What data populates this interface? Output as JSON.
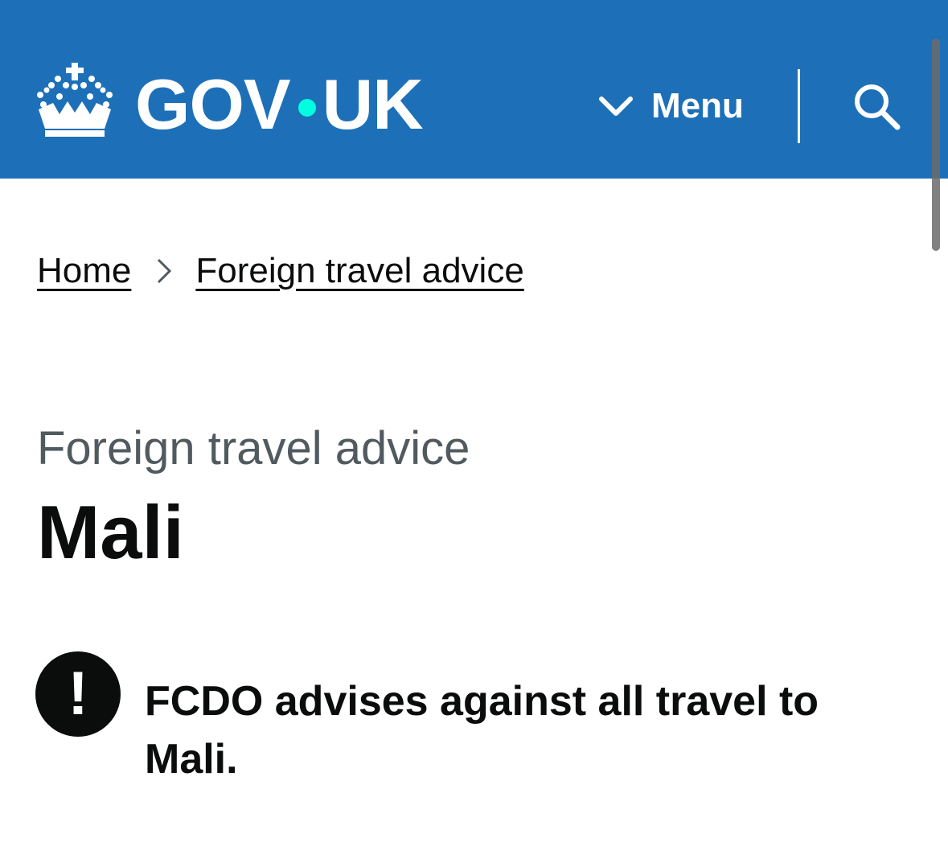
{
  "header": {
    "logo_left": "GOV",
    "logo_right": "UK",
    "menu_label": "Menu",
    "colors": {
      "background": "#1d70b8",
      "logo_dot": "#00ffe0",
      "text": "#ffffff"
    },
    "icons": [
      "crown-icon",
      "chevron-down-icon",
      "search-icon"
    ]
  },
  "breadcrumb": {
    "items": [
      {
        "label": "Home"
      },
      {
        "label": "Foreign travel advice"
      }
    ],
    "separator_icon": "chevron-right-icon"
  },
  "page": {
    "caption": "Foreign travel advice",
    "title": "Mali"
  },
  "warning": {
    "icon": "!",
    "text": "FCDO advises against all travel to Mali."
  }
}
